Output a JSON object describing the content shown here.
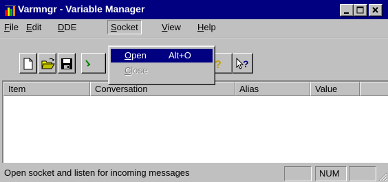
{
  "window": {
    "title": "Varmngr - Variable Manager",
    "controls": {
      "minimize": "_",
      "maximize": "□",
      "close": "×"
    }
  },
  "menubar": {
    "items": [
      {
        "label": "File",
        "accel": "F",
        "rest": "ile"
      },
      {
        "label": "Edit",
        "accel": "E",
        "rest": "dit"
      },
      {
        "label": "DDE",
        "accel": "D",
        "rest": "DE"
      },
      {
        "label": "Socket",
        "accel": "S",
        "rest": "ocket",
        "active": true
      },
      {
        "label": "View",
        "accel": "V",
        "rest": "iew"
      },
      {
        "label": "Help",
        "accel": "H",
        "rest": "elp"
      }
    ]
  },
  "toolbar": {
    "buttons": [
      {
        "name": "new-document-icon"
      },
      {
        "name": "open-folder-icon"
      },
      {
        "name": "save-disk-icon"
      },
      {
        "name": "help-icon"
      },
      {
        "name": "context-help-icon"
      }
    ]
  },
  "socket_menu": {
    "items": [
      {
        "accel": "O",
        "rest": "pen",
        "shortcut": "Alt+O",
        "highlighted": true,
        "enabled": true
      },
      {
        "accel": "C",
        "rest": "lose",
        "shortcut": "",
        "highlighted": false,
        "enabled": false
      }
    ]
  },
  "listview": {
    "columns": [
      "Item",
      "Conversation",
      "Alias",
      "Value"
    ],
    "rows": []
  },
  "statusbar": {
    "message": "Open socket and listen for incoming messages",
    "panels": [
      "",
      "NUM",
      ""
    ]
  },
  "colors": {
    "titlebar": "#000080",
    "face": "#c0c0c0",
    "highlight": "#000080"
  }
}
